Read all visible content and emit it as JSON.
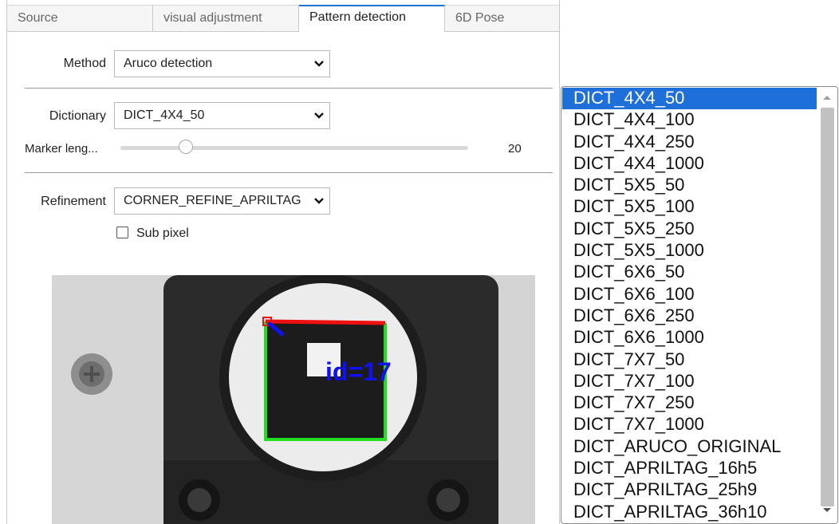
{
  "tabs": [
    {
      "label": "Source",
      "active": false
    },
    {
      "label": "visual adjustment",
      "active": false
    },
    {
      "label": "Pattern detection",
      "active": true
    },
    {
      "label": "6D Pose",
      "active": false
    }
  ],
  "method": {
    "label": "Method",
    "value": "Aruco detection"
  },
  "dictionary": {
    "label": "Dictionary",
    "value": "DICT_4X4_50"
  },
  "marker_length": {
    "label": "Marker leng...",
    "value": "20"
  },
  "refinement": {
    "label": "Refinement",
    "value": "CORNER_REFINE_APRILTAG"
  },
  "sub_pixel": {
    "label": "Sub pixel",
    "checked": false
  },
  "camera_image": {
    "marker_id_text": "id=17"
  },
  "dropdown": {
    "selected": "DICT_4X4_50",
    "options": [
      "DICT_4X4_50",
      "DICT_4X4_100",
      "DICT_4X4_250",
      "DICT_4X4_1000",
      "DICT_5X5_50",
      "DICT_5X5_100",
      "DICT_5X5_250",
      "DICT_5X5_1000",
      "DICT_6X6_50",
      "DICT_6X6_100",
      "DICT_6X6_250",
      "DICT_6X6_1000",
      "DICT_7X7_50",
      "DICT_7X7_100",
      "DICT_7X7_250",
      "DICT_7X7_1000",
      "DICT_ARUCO_ORIGINAL",
      "DICT_APRILTAG_16h5",
      "DICT_APRILTAG_25h9",
      "DICT_APRILTAG_36h10"
    ]
  },
  "colors": {
    "accent": "#1e74d6",
    "selected_bg": "#1e6fd9",
    "marker_green": "#22dd22",
    "marker_red": "#ee1111",
    "marker_blue": "#1111ee"
  }
}
